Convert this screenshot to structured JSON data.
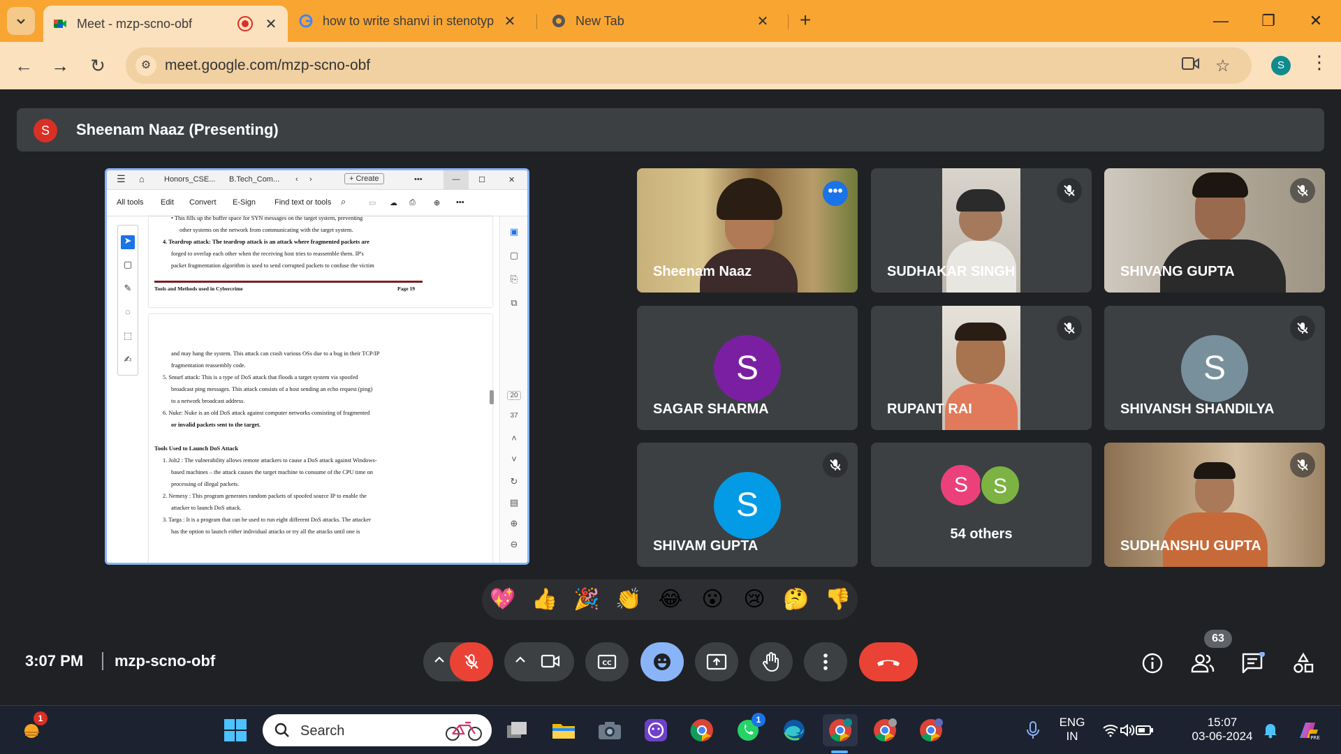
{
  "browser": {
    "tabs": [
      {
        "title": "Meet - mzp-scno-obf",
        "active": true
      },
      {
        "title": "how to write shanvi in stenotyp",
        "active": false
      },
      {
        "title": "New Tab",
        "active": false
      }
    ],
    "url": "meet.google.com/mzp-scno-obf",
    "profile_initial": "S"
  },
  "meet": {
    "presenter_initial": "S",
    "presenting_label": "Sheenam Naaz (Presenting)",
    "meeting_time": "3:07 PM",
    "meeting_code": "mzp-scno-obf",
    "participant_count": "63",
    "tiles": [
      {
        "name": "Sheenam Naaz",
        "type": "video",
        "speaking": true,
        "muted": false
      },
      {
        "name": "SUDHAKAR SINGH",
        "type": "video",
        "muted": true
      },
      {
        "name": "SHIVANG GUPTA",
        "type": "video",
        "muted": true
      },
      {
        "name": "SAGAR SHARMA",
        "type": "avatar",
        "initial": "S",
        "color": "#7b1fa2",
        "muted": false
      },
      {
        "name": "RUPANT RAI",
        "type": "video",
        "muted": true
      },
      {
        "name": "SHIVANSH SHANDILYA",
        "type": "avatar",
        "initial": "S",
        "color": "#78909c",
        "muted": true
      },
      {
        "name": "SHIVAM GUPTA",
        "type": "avatar",
        "initial": "S",
        "color": "#039be5",
        "muted": true
      },
      {
        "name": "54 others",
        "type": "others",
        "initials": [
          "S",
          "S"
        ],
        "colors": [
          "#ec407a",
          "#7cb342"
        ]
      },
      {
        "name": "SUDHANSHU GUPTA",
        "type": "video",
        "muted": true
      }
    ],
    "reactions": [
      "💖",
      "👍",
      "🎉",
      "👏",
      "😂",
      "😮",
      "😢",
      "🤔",
      "👎"
    ]
  },
  "pdf": {
    "tabs": [
      "Honors_CSE...",
      "B.Tech_Com..."
    ],
    "create_label": "Create",
    "menu": [
      "All tools",
      "Edit",
      "Convert",
      "E-Sign",
      "Find text or tools"
    ],
    "page_current": "20",
    "page_total": "37",
    "page1_lines": [
      "•   This fills up the buffer space for SYN messages on the target system, preventing",
      "other systems on the network from communicating with the target system.",
      "4.  Teardrop attack: The teardrop attack is an attack where fragmented packets are",
      "forged to overlap each other when the receiving host tries to reassemble them. IP's",
      "packet fragmentation algorithm is used to send corrupted packets to confuse the victim"
    ],
    "footer_left": "Tools and Methods used in Cybercrime",
    "footer_right": "Page 19",
    "page2_lines": [
      "and may hang the system. This attack can crash various OSs due to a bug in their TCP/IP",
      "fragmentation reassembly code.",
      "5.  Smurf attack: This is a type of DoS attack that floods a target system via spoofed",
      "broadcast ping messages. This attack consists of a host sending an echo request (ping)",
      "to a network broadcast address.",
      "6.  Nuke: Nuke is an old DoS attack against computer networks consisting of fragmented",
      "or invalid packets sent to the target.",
      "",
      "Tools Used to Launch DoS Attack",
      "1.  Jolt2 : The vulnerability allows remote attackers to cause a DoS attack against Windows-",
      "based machines – the attack causes the target machine to consume of the CPU time on",
      "processing of illegal packets.",
      "2.  Nemesy : This program generates random packets of spoofed source IP to enable the",
      "attacker to launch DoS attack.",
      "3.  Targa : It is a program that can be used to run eight different DoS attacks. The attacker",
      "has the option to launch either individual attacks or try all the attacks until one is"
    ]
  },
  "taskbar": {
    "search_label": "Search",
    "lang_line1": "ENG",
    "lang_line2": "IN",
    "clock_time": "15:07",
    "clock_date": "03-06-2024",
    "weather_badge": "1",
    "whatsapp_badge": "1"
  }
}
